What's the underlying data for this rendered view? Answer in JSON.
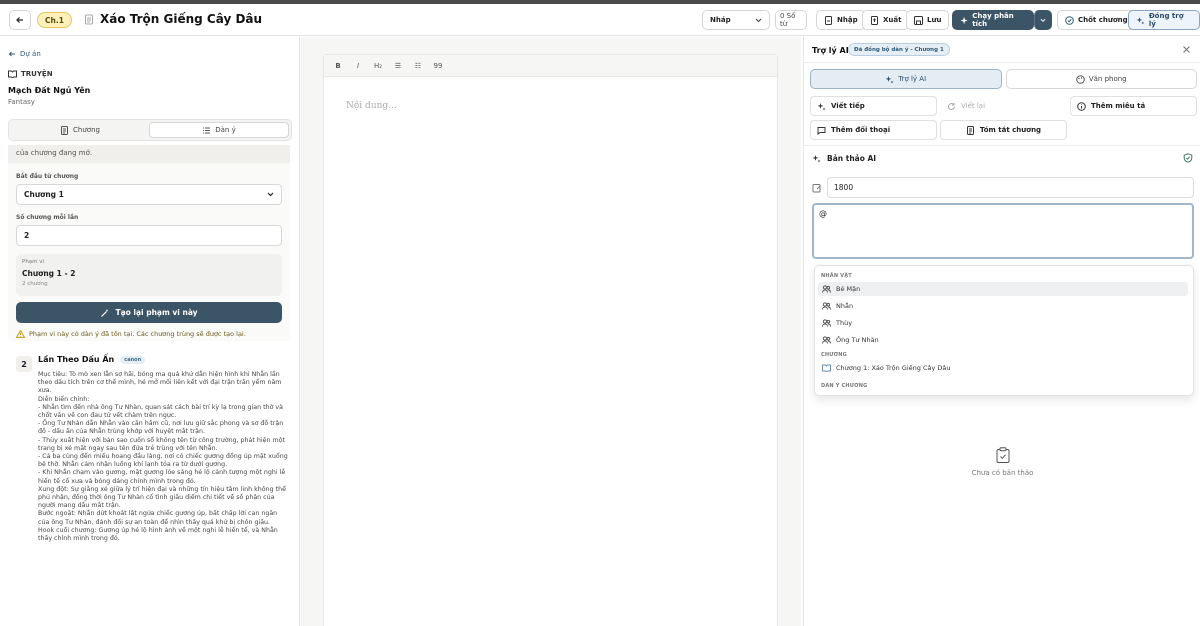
{
  "header": {
    "chapter_badge": "Ch.1",
    "title": "Xáo Trộn Giếng Cây Dâu",
    "status_select": "Nháp",
    "word_count": "0 Số từ",
    "import_label": "Nhập",
    "export_label": "Xuất",
    "save_label": "Lưu",
    "run_analysis_label": "Chạy phân tích",
    "finalize_label": "Chốt chương",
    "close_assistant_label": "Đóng trợ lý"
  },
  "left": {
    "back_link": "Dự án",
    "section_label": "TRUYỆN",
    "story_title": "Mạch Đất Ngủ Yên",
    "genre": "Fantasy",
    "tabs": [
      {
        "label": "Chương"
      },
      {
        "label": "Dàn ý"
      }
    ],
    "note_strip": "của chương đang mở.",
    "start_label": "Bắt đầu từ chương",
    "start_value": "Chương 1",
    "per_batch_label": "Số chương mỗi lần",
    "per_batch_value": "2",
    "range_label": "Phạm vi",
    "range_value": "Chương 1 - 2",
    "range_sub": "2 chương",
    "regen_button": "Tạo lại phạm vi này",
    "warning": "Phạm vi này có dàn ý đã tồn tại. Các chương trùng sẽ được tạo lại.",
    "outline": {
      "number": "2",
      "title": "Lần Theo Dấu Ấn",
      "tag": "canon",
      "paragraphs": [
        "Mục tiêu: Tò mò xen lẫn sợ hãi, bóng ma quá khứ dẫn hiện hình khi Nhẫn lần theo dấu tích trên cơ thể mình, hé mở mối liên kết với đại trận trấn yểm năm xưa.",
        "Diễn biến chính:",
        "- Nhẫn tìm đến nhà ông Tư Nhàn, quan sát cách bài trí kỳ lạ trong gian thờ và chốt vấn về con đau từ vết chàm trên ngực.",
        "- Ông Tư Nhàn dẫn Nhẫn vào căn hầm cũ, nơi lưu giữ sắc phong và sơ đồ trận đồ - dấu ấn của Nhẫn trùng khớp với huyệt mắt trận.",
        "- Thùy xuất hiện với bản sao cuốn sổ không tên từ công trường, phát hiện một trang bị xé mất ngay sau tên đứa trẻ trùng với tên Nhẫn.",
        "- Cả ba cùng đến miếu hoang đầu làng, nơi có chiếc gương đồng úp mặt xuống bệ thờ. Nhẫn cảm nhận luồng khí lạnh tỏa ra từ dưới gương.",
        "- Khi Nhẫn chạm vào gương, mặt gương lóe sáng hé lộ cảnh tượng một nghi lễ hiến tế cổ xưa và bóng dáng chính mình trong đó.",
        "Xung đột: Sự giằng xé giữa lý trí hiện đại và những tín hiệu tâm linh không thể phủ nhận, đồng thời ông Tư Nhàn cố tình giấu diếm chi tiết về số phận của người mang dấu mắt trận.",
        "Bước ngoặt: Nhẫn dứt khoát lật ngửa chiếc gương úp, bất chấp lời can ngăn của ông Tư Nhàn, đánh đổi sự an toàn để nhìn thấy quá khứ bị chôn giấu.",
        "Hook cuối chương: Gương úp hé lộ hình ảnh về một nghi lễ hiến tế, và Nhẫn thấy chính mình trong đó."
      ]
    }
  },
  "editor": {
    "toolbar": [
      "B",
      "I",
      "H₂",
      "☰",
      "☷",
      "99"
    ],
    "placeholder": "Nội dung..."
  },
  "assistant": {
    "title": "Trợ lý AI",
    "sync_tag": "Đã đồng bộ dàn ý - Chương 1",
    "tabs": [
      {
        "label": "Trợ lý AI"
      },
      {
        "label": "Văn phong"
      }
    ],
    "actions": {
      "continue": "Viết tiếp",
      "rewrite": "Viết lại",
      "describe": "Thêm miêu tả",
      "dialogue": "Thêm đối thoại",
      "summary": "Tóm tắt chương"
    },
    "draft_title": "Bản thảo AI",
    "length_value": "1800",
    "prompt_value": "@",
    "mention": {
      "group_characters": "NHÂN VẬT",
      "characters": [
        "Bé Mận",
        "Nhẫn",
        "Thùy",
        "Ông Tư Nhàn"
      ],
      "group_chapters": "CHƯƠNG",
      "chapters": [
        "Chương 1: Xáo Trộn Giếng Cây Dâu"
      ],
      "group_outline": "DÀN Ý CHƯƠNG"
    },
    "empty_state": "Chưa có bản thảo"
  }
}
